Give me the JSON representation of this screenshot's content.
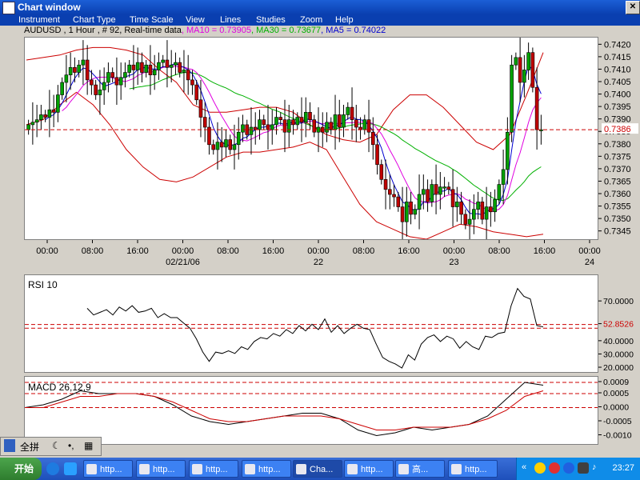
{
  "window": {
    "title": "Chart window"
  },
  "menu": [
    "Instrument",
    "Chart Type",
    "Time Scale",
    "View",
    "Lines",
    "Studies",
    "Zoom",
    "Help"
  ],
  "info": {
    "symbol": "AUDUSD , 1 Hour , # 92, Real-time data",
    "ma10": ", MA10 = 0.73905",
    "ma30": ", MA30 = 0.73677",
    "ma5": ", MA5 = 0.74022",
    "colors": {
      "ma10": "#e000e0",
      "ma30": "#00b000",
      "ma5": "#0000d0",
      "boll": "#cc0000",
      "current": "#cc0000"
    }
  },
  "price_chart": {
    "y_ticks": [
      "0.7420",
      "0.7415",
      "0.7410",
      "0.7405",
      "0.7400",
      "0.7395",
      "0.7390",
      "0.7385",
      "0.7380",
      "0.7375",
      "0.7370",
      "0.7365",
      "0.7360",
      "0.7355",
      "0.7350",
      "0.7345"
    ],
    "current_label": "0.7386",
    "x_ticks": [
      "00:00",
      "08:00",
      "16:00",
      "00:00",
      "08:00",
      "16:00",
      "00:00",
      "08:00",
      "16:00",
      "00:00",
      "08:00",
      "16:00",
      "00:00"
    ],
    "date_labels": [
      "02/21/06",
      "22",
      "23",
      "24"
    ]
  },
  "chart_data": [
    {
      "type": "candlestick",
      "title": "AUDUSD , 1 Hour",
      "ylim": [
        0.7342,
        0.7423
      ],
      "current_price": 0.7386,
      "closes": [
        0.7388,
        0.7389,
        0.739,
        0.7392,
        0.7391,
        0.7394,
        0.7393,
        0.74,
        0.7405,
        0.7408,
        0.7411,
        0.7409,
        0.7412,
        0.7414,
        0.7406,
        0.7404,
        0.74,
        0.7402,
        0.7405,
        0.7409,
        0.7407,
        0.7404,
        0.7407,
        0.7409,
        0.7412,
        0.741,
        0.7413,
        0.7409,
        0.7412,
        0.7408,
        0.741,
        0.7413,
        0.7414,
        0.7411,
        0.7412,
        0.7413,
        0.7409,
        0.741,
        0.7406,
        0.7404,
        0.7398,
        0.7391,
        0.7387,
        0.738,
        0.7378,
        0.7381,
        0.7379,
        0.7382,
        0.7378,
        0.738,
        0.7385,
        0.7388,
        0.7384,
        0.7387,
        0.7386,
        0.739,
        0.7388,
        0.7386,
        0.7388,
        0.7391,
        0.739,
        0.7385,
        0.739,
        0.7388,
        0.7391,
        0.7389,
        0.7393,
        0.739,
        0.7385,
        0.7387,
        0.7385,
        0.7389,
        0.7386,
        0.7392,
        0.7387,
        0.7392,
        0.7395,
        0.739,
        0.7387,
        0.7386,
        0.739,
        0.7385,
        0.738,
        0.7372,
        0.7366,
        0.7362,
        0.736,
        0.7359,
        0.7355,
        0.7349,
        0.7357,
        0.7352,
        0.7354,
        0.736,
        0.7362,
        0.7357,
        0.7364,
        0.736,
        0.7363,
        0.7363,
        0.7362,
        0.7355,
        0.7357,
        0.7352,
        0.7348,
        0.735,
        0.7354,
        0.7357,
        0.735,
        0.7355,
        0.7353,
        0.7358,
        0.7364,
        0.737,
        0.7385,
        0.7412,
        0.7415,
        0.7405,
        0.741,
        0.7417,
        0.7403,
        0.7386,
        0.7386
      ],
      "bollinger_upper": [
        0.7414,
        0.7415,
        0.7416,
        0.7418,
        0.7419,
        0.7419,
        0.7418,
        0.7416,
        0.741,
        0.7405,
        0.7396,
        0.7393,
        0.7393,
        0.7394,
        0.7395,
        0.7395,
        0.7393,
        0.7388,
        0.7384,
        0.7382,
        0.7381,
        0.7384,
        0.7394,
        0.74,
        0.74,
        0.7395,
        0.7388,
        0.7381,
        0.7378,
        0.7384,
        0.74,
        0.7417
      ],
      "bollinger_lower": [
        0.7388,
        0.739,
        0.7396,
        0.7401,
        0.7396,
        0.7388,
        0.7378,
        0.7371,
        0.7366,
        0.7365,
        0.7367,
        0.7371,
        0.7375,
        0.7377,
        0.7377,
        0.7378,
        0.7379,
        0.7381,
        0.7378,
        0.7367,
        0.7356,
        0.7349,
        0.7346,
        0.7343,
        0.7342,
        0.7345,
        0.7348,
        0.7347,
        0.7345,
        0.7344,
        0.7343,
        0.7344
      ]
    },
    {
      "type": "line",
      "title": "RSI 10",
      "ylim": [
        17,
        90
      ],
      "ticks": [
        70,
        52.8526,
        40,
        30,
        20
      ],
      "tick_labels": [
        "70.0000",
        "52.8526",
        "40.0000",
        "30.0000",
        "20.0000"
      ],
      "current_value": 52.8526,
      "reference_lines": [
        52.8526,
        50
      ],
      "values": [
        65,
        60,
        62,
        64,
        60,
        66,
        63,
        67,
        62,
        63,
        65,
        58,
        61,
        58,
        58,
        54,
        50,
        42,
        32,
        25,
        32,
        31,
        33,
        31,
        36,
        34,
        40,
        43,
        42,
        46,
        44,
        49,
        46,
        52,
        48,
        53,
        49,
        57,
        47,
        52,
        46,
        50,
        53,
        50,
        49,
        38,
        28,
        25,
        23,
        20,
        30,
        26,
        38,
        43,
        45,
        40,
        44,
        42,
        35,
        40,
        36,
        34,
        44,
        43,
        46,
        47,
        67,
        80,
        74,
        72,
        52,
        51
      ]
    },
    {
      "type": "line",
      "title": "MACD 26,12,9",
      "ylim": [
        -0.0013,
        0.0011
      ],
      "tick_labels": [
        "0.0009",
        "0.0005",
        "0.0000",
        "-0.0005",
        "-0.0010"
      ],
      "reference_lines": [
        0.0009,
        0.0005,
        0.0
      ],
      "series": [
        {
          "name": "MACD",
          "values": [
            0.0,
            0.0001,
            0.0003,
            0.0006,
            0.0005,
            0.0005,
            0.0005,
            0.0004,
            0.0001,
            -0.0003,
            -0.0005,
            -0.0006,
            -0.0005,
            -0.0004,
            -0.0003,
            -0.0002,
            -0.0002,
            -0.0004,
            -0.0008,
            -0.001,
            -0.0009,
            -0.0007,
            -0.0008,
            -0.0007,
            -0.0006,
            -0.0003,
            0.0003,
            0.0009,
            0.0008
          ]
        },
        {
          "name": "Signal",
          "values": [
            0.0,
            0.0,
            0.0002,
            0.0004,
            0.0004,
            0.0005,
            0.0005,
            0.0004,
            0.0002,
            -0.0001,
            -0.0004,
            -0.0005,
            -0.0005,
            -0.0004,
            -0.0003,
            -0.0003,
            -0.0003,
            -0.0004,
            -0.0006,
            -0.0008,
            -0.0008,
            -0.0007,
            -0.0007,
            -0.0007,
            -0.0006,
            -0.0004,
            -0.0001,
            0.0004,
            0.0006
          ]
        }
      ]
    }
  ],
  "ime": {
    "label": "全拼"
  },
  "taskbar": {
    "start": "开始",
    "items": [
      "http...",
      "http...",
      "http...",
      "http...",
      "Cha...",
      "http...",
      "高...",
      "http..."
    ],
    "clock": "23:27"
  }
}
